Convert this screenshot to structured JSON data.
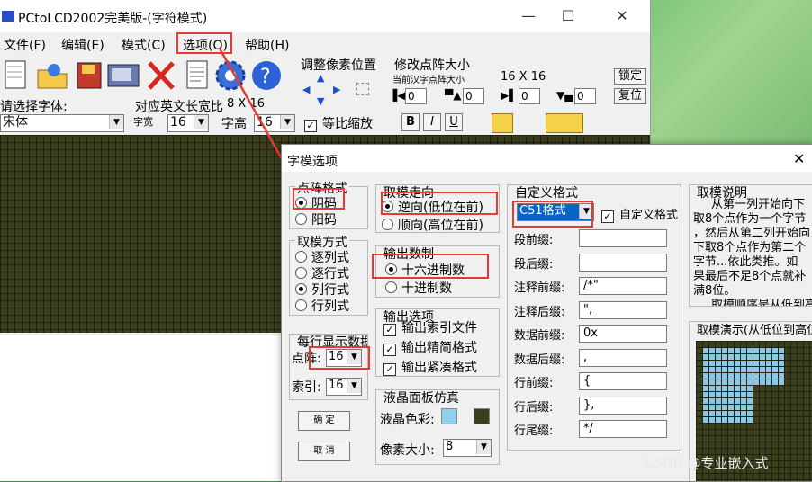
{
  "main": {
    "title": "PCtoLCD2002完美版-(字符模式)",
    "menus": [
      "文件(F)",
      "编辑(E)",
      "模式(C)",
      "选项(O)",
      "帮助(H)"
    ],
    "pixel_pos_label": "调整像素位置",
    "dot_size_label": "修改点阵大小",
    "current_size_label": "当前汉字点阵大小",
    "current_size_value": "16 X 16",
    "lock_button": "锁定",
    "restore_button": "复位",
    "spin_values": [
      "0",
      "0",
      "0",
      "0"
    ],
    "font_label": "请选择字体:",
    "font_value": "宋体",
    "width_ratio_label": "对应英文长宽比",
    "width_ratio_value": "8 X 16",
    "char_width_label": "字宽",
    "char_width_value": "16",
    "char_height_label": "字高",
    "char_height_value": "16",
    "proportional_label": "等比缩放",
    "bold_btn": "B",
    "italic_btn": "I",
    "underline_btn": "U"
  },
  "dialog": {
    "title": "字模选项",
    "matrix_format": {
      "caption": "点阵格式",
      "options": [
        "阴码",
        "阳码"
      ],
      "selected": 0
    },
    "scan_mode": {
      "caption": "取模方式",
      "options": [
        "逐列式",
        "逐行式",
        "列行式",
        "行列式"
      ],
      "selected": 2
    },
    "per_line": {
      "caption": "每行显示数据",
      "dot_label": "点阵:",
      "dot_value": "16",
      "index_label": "索引:",
      "index_value": "16"
    },
    "ok_button": "确 定",
    "cancel_button": "取 消",
    "direction": {
      "caption": "取模走向",
      "options": [
        "逆向(低位在前)",
        "顺向(高位在前)"
      ],
      "selected": 0
    },
    "output_base": {
      "caption": "输出数制",
      "options": [
        "十六进制数",
        "十进制数"
      ],
      "selected": 0
    },
    "output_opts": {
      "caption": "输出选项",
      "items": [
        "输出索引文件",
        "输出精简格式",
        "输出紧凑格式"
      ]
    },
    "lcd_sim": {
      "caption": "液晶面板仿真",
      "color_label": "液晶色彩:",
      "pixel_label": "像素大小:",
      "pixel_value": "8"
    },
    "custom": {
      "caption": "自定义格式",
      "format_value": "C51格式",
      "custom_check": "自定义格式",
      "rows": [
        {
          "label": "段前缀:",
          "value": ""
        },
        {
          "label": "段后缀:",
          "value": ""
        },
        {
          "label": "注释前缀:",
          "value": "/*\""
        },
        {
          "label": "注释后缀:",
          "value": "\","
        },
        {
          "label": "数据前缀:",
          "value": "0x"
        },
        {
          "label": "数据后缀:",
          "value": ","
        },
        {
          "label": "行前缀:",
          "value": "{"
        },
        {
          "label": "行后缀:",
          "value": "},"
        },
        {
          "label": "行尾缀:",
          "value": "*/"
        }
      ]
    },
    "explain": {
      "caption": "取模说明",
      "lines": [
        "从第一列开始向下",
        "取8个点作为一个字节",
        "，然后从第二列开始向",
        "下取8个点作为第二个",
        "字节...依此类推。如",
        "果最后不足8个点就补",
        "满8位。",
        "取模顺序是从低到高"
      ]
    },
    "demo_caption": "取模演示(从低位到高位)"
  },
  "watermark": "CSDN @专业嵌入式",
  "colors": {
    "lcd_bg": "#3b3f1c",
    "lcd_on": "#8ed0ee",
    "highlight": "#e53935",
    "selection": "#0a64c8"
  }
}
